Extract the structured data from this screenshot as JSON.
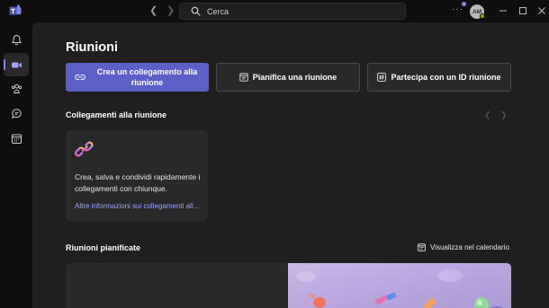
{
  "search": {
    "placeholder": "Cerca"
  },
  "account": {
    "initials": "AM"
  },
  "page": {
    "title": "Riunioni"
  },
  "actions": {
    "create_link": "Crea un collegamento alla riunione",
    "schedule": "Pianifica una riunione",
    "join_id": "Partecipa con un ID riunione"
  },
  "links_section": {
    "title": "Collegamenti alla riunione",
    "card": {
      "text": "Crea, salva e condividi rapidamente i collegamenti con chiunque.",
      "link": "Altre informazioni sui collegamenti all..."
    }
  },
  "scheduled_section": {
    "title": "Riunioni pianificate",
    "calendar_link": "Visualizza nel calendario"
  },
  "icons": {
    "rail": [
      "bell-icon",
      "video-icon",
      "people-icon",
      "chat-icon",
      "calendar-icon"
    ]
  },
  "colors": {
    "accent": "#5b5fc7",
    "link": "#9ea3ff",
    "presence": "#6bb700"
  }
}
